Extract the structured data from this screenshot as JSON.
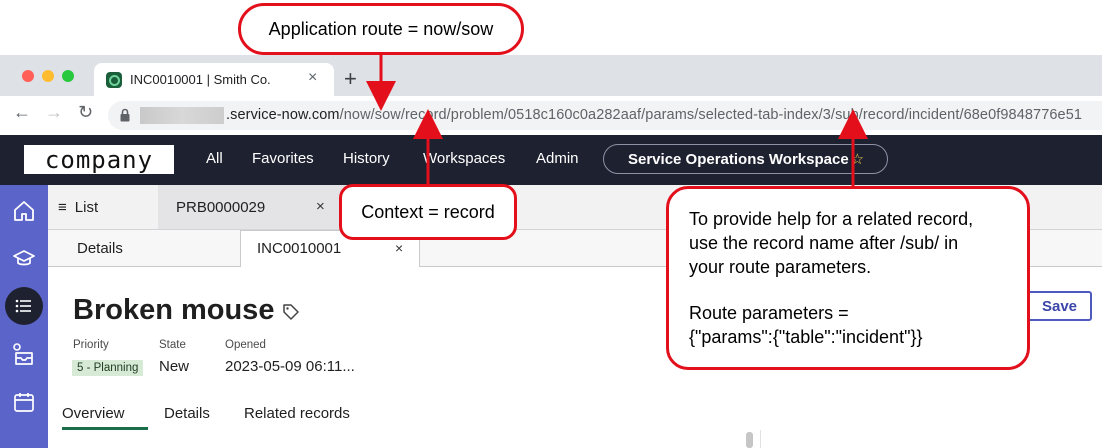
{
  "browser": {
    "tab_title": "INC0010001 | Smith Co.",
    "tab_close": "×",
    "new_tab": "+",
    "url_host": ".service-now.com",
    "url_path": "/now/sow/record/problem/0518c160c0a282aaf/params/selected-tab-index/3/sub/record/incident/68e0f9848776e51"
  },
  "app": {
    "logo": "company",
    "nav": [
      "All",
      "Favorites",
      "History",
      "Workspaces",
      "Admin"
    ],
    "workspace_pill": "Service Operations Workspace",
    "star": "☆"
  },
  "workspace_tabs": {
    "list_label": "List",
    "problem_tab": "PRB0000029",
    "close": "×"
  },
  "sub_tabs": {
    "details": "Details",
    "incident": "INC0010001",
    "close": "×"
  },
  "record": {
    "title": "Broken mouse",
    "priority_label": "Priority",
    "priority_value": "5 - Planning",
    "state_label": "State",
    "state_value": "New",
    "opened_label": "Opened",
    "opened_value": "2023-05-09 06:11...",
    "save_label": "Save",
    "tabs": [
      "Overview",
      "Details",
      "Related records"
    ]
  },
  "callouts": {
    "route": "Application route = now/sow",
    "context": "Context = record",
    "help_line1": "To provide help for a related record,",
    "help_line2": "use the record name after /sub/ in",
    "help_line3": "your route parameters.",
    "help_line4": "Route parameters =",
    "help_line5": "{\"params\":{\"table\":\"incident\"}}"
  },
  "colors": {
    "annotation_red": "#e3101b",
    "app_header": "#1e2130",
    "rail": "#5b64c8",
    "accent_green": "#1b6e4a",
    "save_blue": "#4f5ac0"
  },
  "icons": [
    "lock-icon",
    "home-icon",
    "learning-icon",
    "list-icon",
    "inbox-icon",
    "calendar-icon",
    "tag-icon",
    "star-icon"
  ]
}
